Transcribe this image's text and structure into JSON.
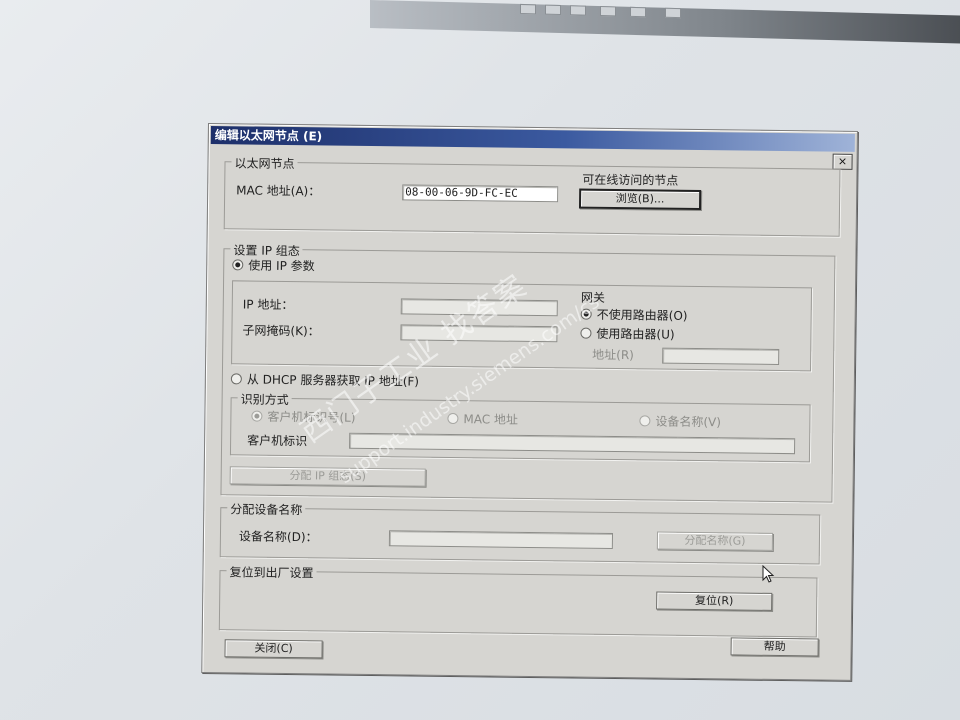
{
  "window": {
    "title": "编辑以太网节点 (E)",
    "close_glyph": "×"
  },
  "ethernet_node": {
    "group_title": "以太网节点",
    "mac_label": "MAC 地址(A)：",
    "mac_value": "08-00-06-9D-FC-EC",
    "accessible_nodes_label": "可在线访问的节点",
    "browse_button": "浏览(B)..."
  },
  "ip_config": {
    "group_title": "设置 IP 组态",
    "use_ip_params_label": "使用 IP 参数",
    "ip_address_label": "IP 地址：",
    "subnet_mask_label": "子网掩码(K)：",
    "gateway": {
      "title": "网关",
      "no_router_label": "不使用路由器(O)",
      "use_router_label": "使用路由器(U)",
      "address_label": "地址(R)"
    },
    "dhcp_label": "从 DHCP 服务器获取 IP 地址(F)",
    "identification": {
      "title": "识别方式",
      "client_id_option": "客户机标识号(L)",
      "mac_option": "MAC 地址",
      "device_name_option": "设备名称(V)",
      "client_id_label": "客户机标识"
    },
    "assign_button": "分配 IP 组态(S)"
  },
  "device_name": {
    "group_title": "分配设备名称",
    "label": "设备名称(D)：",
    "assign_button": "分配名称(G)"
  },
  "factory_reset": {
    "group_title": "复位到出厂设置",
    "reset_button": "复位(R)"
  },
  "footer": {
    "close_button": "关闭(C)",
    "help_button": "帮助"
  },
  "watermark": {
    "text": "西门子工业  找答案",
    "url": "support.industry.siemens.com/cs"
  }
}
